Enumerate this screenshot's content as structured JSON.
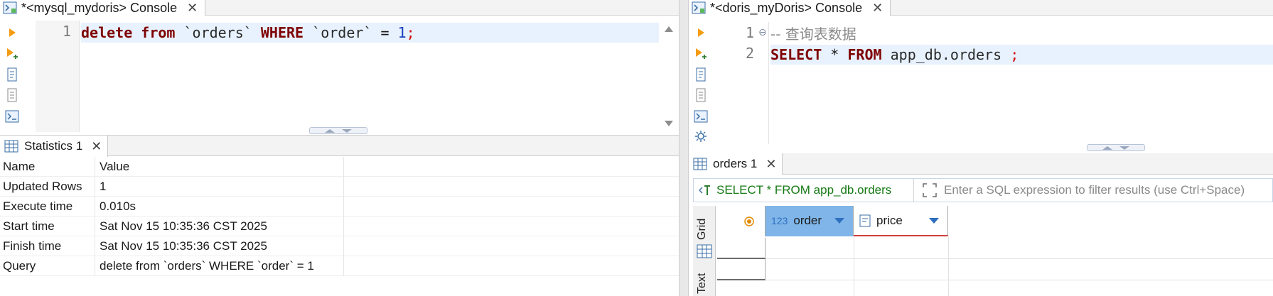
{
  "left": {
    "tab_title": "*<mysql_mydoris> Console",
    "editor": {
      "line_numbers": [
        "1"
      ],
      "line1": {
        "kw_delete": "delete",
        "kw_from": "from",
        "table": "`orders`",
        "kw_where": "WHERE",
        "column": "`order`",
        "op": "=",
        "value": "1",
        "semicolon": ";"
      }
    },
    "results_tab": "Statistics 1",
    "stats": {
      "header": {
        "name": "Name",
        "value": "Value"
      },
      "rows": [
        {
          "name": "Updated Rows",
          "value": "1"
        },
        {
          "name": "Execute time",
          "value": "0.010s"
        },
        {
          "name": "Start time",
          "value": "Sat Nov 15 10:35:36 CST 2025"
        },
        {
          "name": "Finish time",
          "value": "Sat Nov 15 10:35:36 CST 2025"
        },
        {
          "name": "Query",
          "value": "delete from `orders` WHERE `order` = 1"
        }
      ]
    }
  },
  "right": {
    "tab_title": "*<doris_myDoris> Console",
    "editor": {
      "line_numbers": [
        "1",
        "2"
      ],
      "line1_comment": "-- 查询表数据",
      "line2": {
        "kw_select": "SELECT",
        "star": "*",
        "kw_from": "FROM",
        "table": "app_db.orders",
        "semicolon": ";"
      }
    },
    "results_tab": "orders 1",
    "filter": {
      "sql": "SELECT * FROM app_db.orders",
      "placeholder": "Enter a SQL expression to filter results (use Ctrl+Space)"
    },
    "side_tabs": {
      "grid": "Grid",
      "text": "Text"
    },
    "columns": [
      {
        "type_badge": "123",
        "name": "order"
      },
      {
        "type_badge": "",
        "name": "price"
      }
    ]
  },
  "colors": {
    "keyword": "#7f0000",
    "current_line": "#e8f2fe",
    "selected_column": "#7fb5e8",
    "filter_sql": "#157a15"
  }
}
